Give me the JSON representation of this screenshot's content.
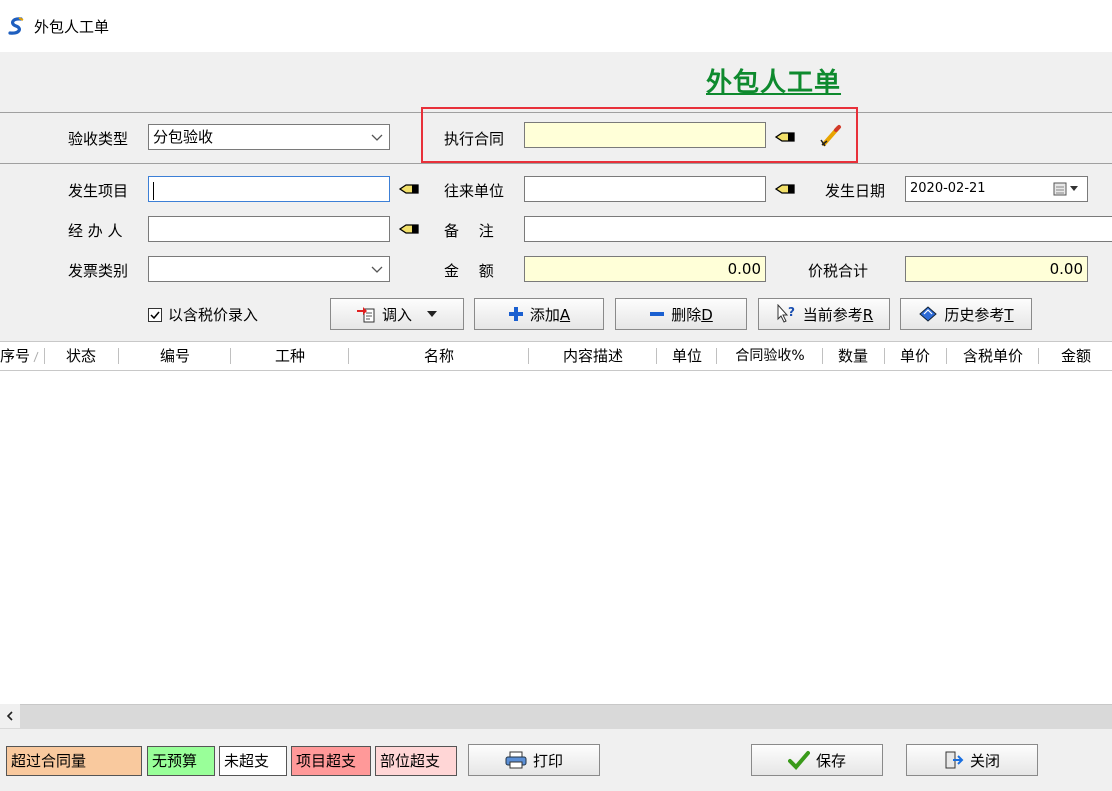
{
  "window": {
    "title": "外包人工单"
  },
  "form": {
    "title": "外包人工单"
  },
  "fields": {
    "acceptance_type": {
      "label": "验收类型",
      "value": "分包验收"
    },
    "contract": {
      "label": "执行合同",
      "value": ""
    },
    "project": {
      "label": "发生项目",
      "value": ""
    },
    "partner": {
      "label": "往来单位",
      "value": ""
    },
    "date": {
      "label": "发生日期",
      "value": "2020-02-21"
    },
    "handler": {
      "label": "经 办 人",
      "value": ""
    },
    "remark": {
      "label": "备　 注",
      "value": ""
    },
    "invoice_type": {
      "label": "发票类别",
      "value": ""
    },
    "amount": {
      "label": "金　 额",
      "value": "0.00"
    },
    "total_tax": {
      "label": "价税合计",
      "value": "0.00"
    }
  },
  "toolbar": {
    "tax_included_label": "以含税价录入",
    "import_label": "调入",
    "add_label": "添加",
    "add_key": "A",
    "delete_label": "删除",
    "delete_key": "D",
    "current_ref_label": "当前参考",
    "current_ref_key": "R",
    "history_ref_label": "历史参考",
    "history_ref_key": "T"
  },
  "grid": {
    "columns": [
      "序号",
      "状态",
      "编号",
      "工种",
      "名称",
      "内容描述",
      "单位",
      "合同验收%",
      "数量",
      "单价",
      "含税单价",
      "金额"
    ],
    "rows": []
  },
  "legend": {
    "over_contract": "超过合同量",
    "no_budget": "无预算",
    "not_over": "未超支",
    "project_over": "项目超支",
    "part_over": "部位超支"
  },
  "buttons": {
    "print": "打印",
    "save": "保存",
    "close": "关闭"
  },
  "colors": {
    "title_green": "#0e8a2e",
    "highlight_red": "#e8303a",
    "yellow_field": "#ffffd8",
    "legend_over_contract": "#f9c99e",
    "legend_no_budget": "#99ff99",
    "legend_project_over": "#ff9999",
    "legend_part_over": "#ffd6d6"
  }
}
